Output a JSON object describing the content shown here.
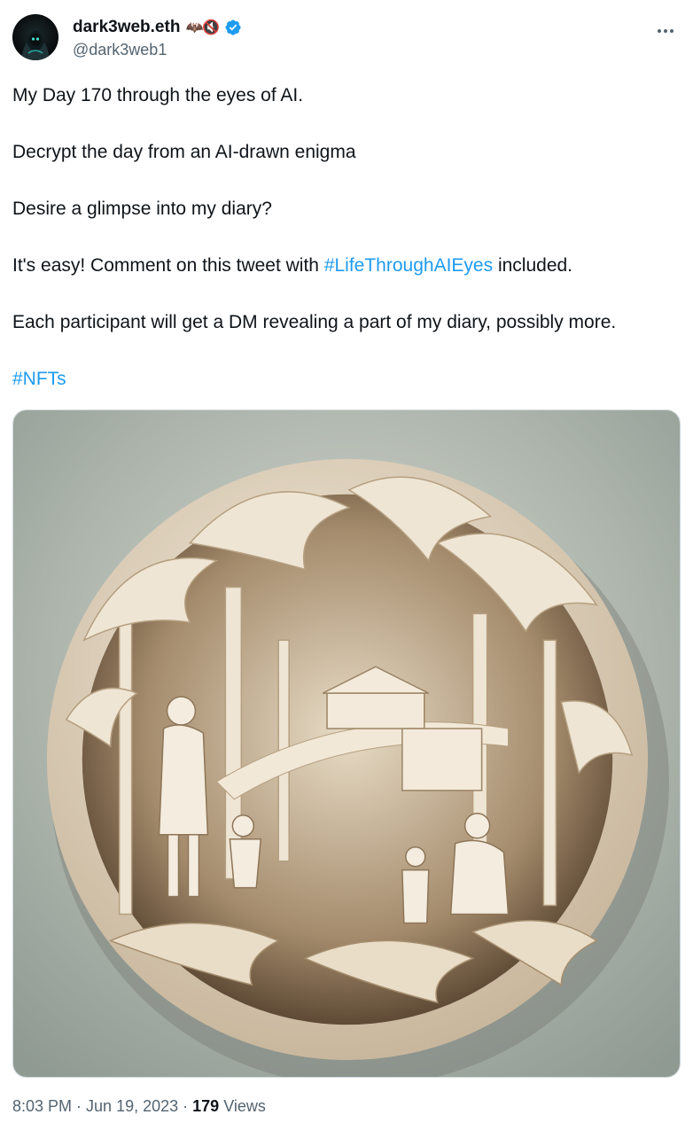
{
  "author": {
    "display_name": "dark3web.eth",
    "name_emojis": "🦇🔇",
    "handle": "@dark3web1",
    "verified": true
  },
  "tweet": {
    "line1": "My Day 170 through the eyes of AI.",
    "line2": "Decrypt the day from an AI-drawn enigma",
    "line3": "Desire a glimpse into my diary?",
    "line4_pre": "It's easy! Comment on this tweet with ",
    "line4_tag": "#LifeThroughAIEyes",
    "line4_post": " included.",
    "line5": "Each participant will get a DM revealing a part of my diary, possibly more.",
    "hashtag_nfts": "#NFTs"
  },
  "meta": {
    "time": "8:03 PM",
    "sep1": "·",
    "date": "Jun 19, 2023",
    "sep2": "·",
    "views_count": "179",
    "views_label": "Views"
  },
  "colors": {
    "link": "#1d9bf0",
    "text": "#0f1419",
    "secondary": "#536471",
    "verified": "#1d9bf0"
  },
  "icons": {
    "more": "more-horizontal-icon",
    "verified": "verified-badge-icon"
  }
}
